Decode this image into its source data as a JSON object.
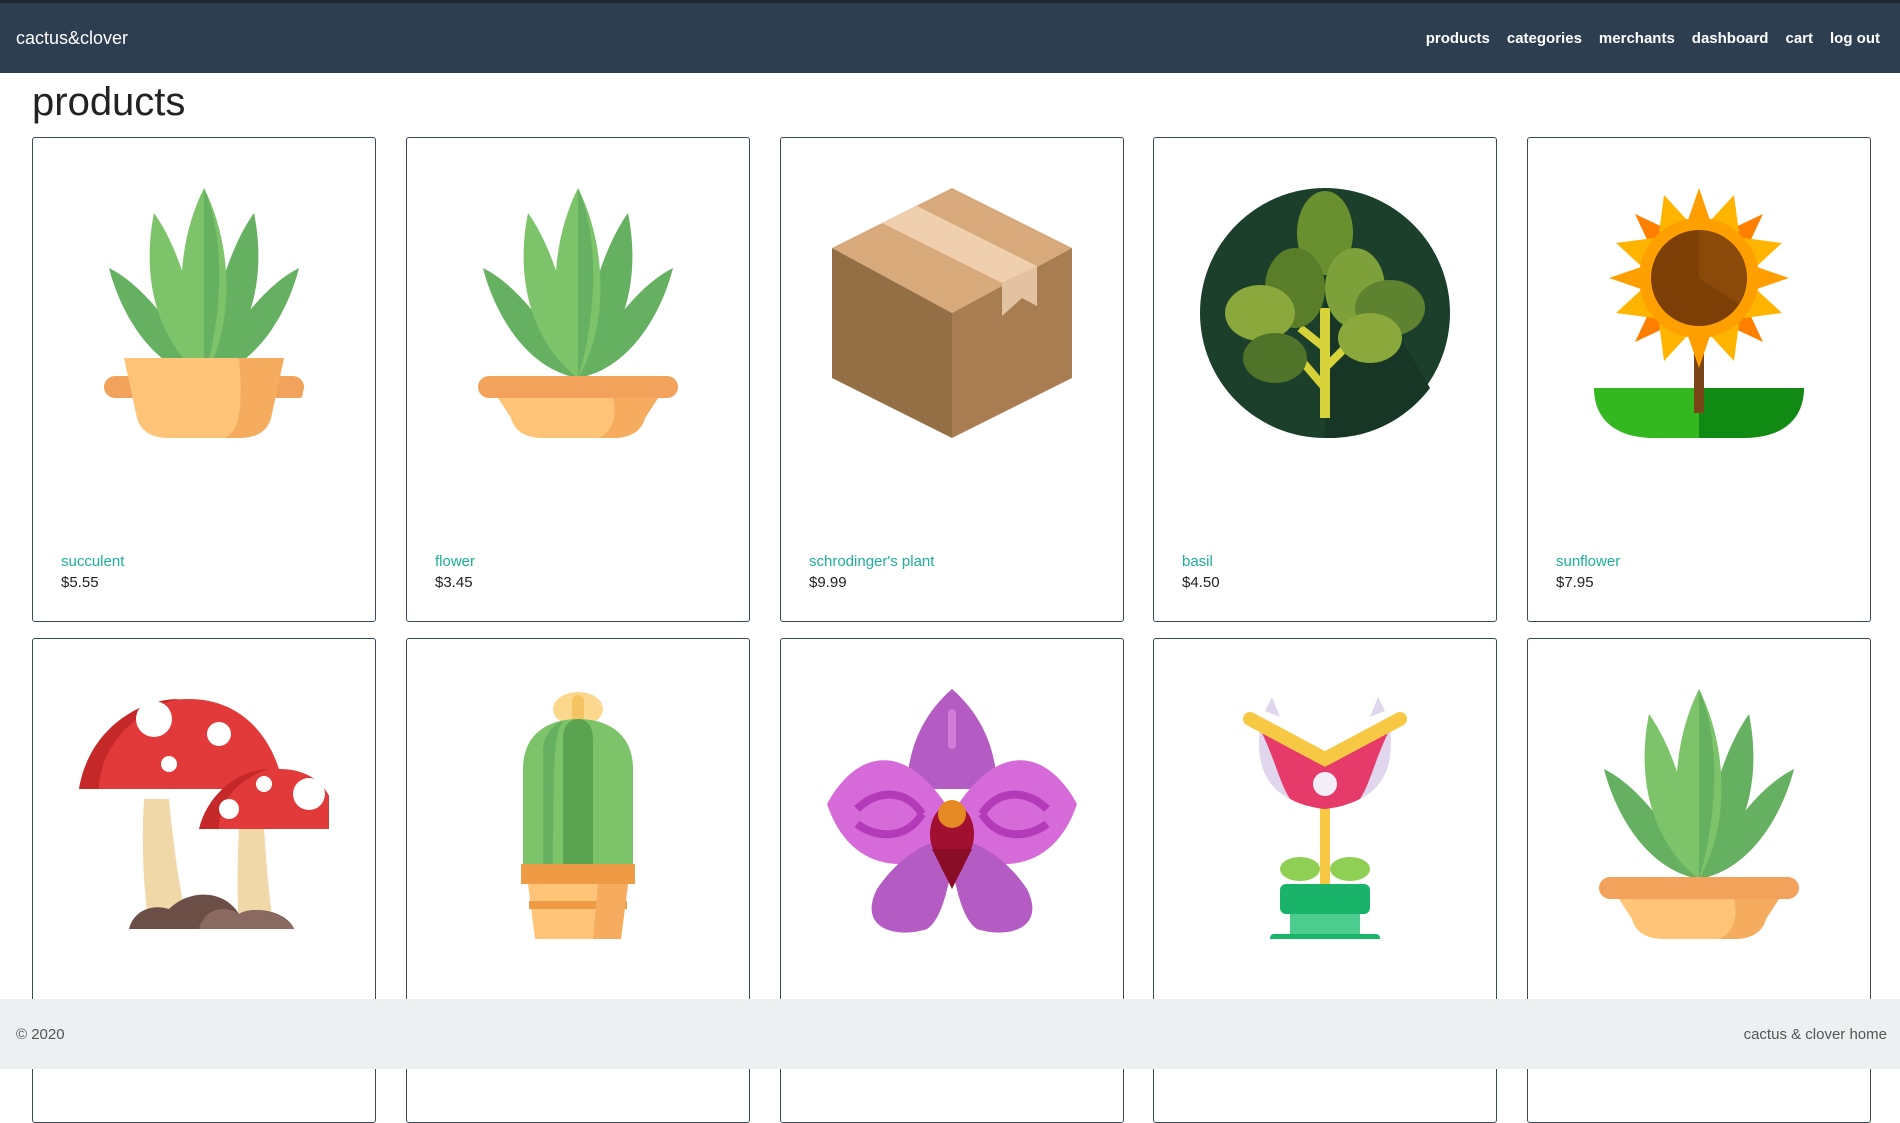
{
  "nav": {
    "brand": "cactus&clover",
    "links": [
      "products",
      "categories",
      "merchants",
      "dashboard",
      "cart",
      "log out"
    ]
  },
  "page": {
    "title": "products"
  },
  "products": [
    {
      "name": "succulent",
      "price": "$5.55",
      "icon": "succulent-icon"
    },
    {
      "name": "flower",
      "price": "$3.45",
      "icon": "succulent-icon"
    },
    {
      "name": "schrodinger's plant",
      "price": "$9.99",
      "icon": "box-icon"
    },
    {
      "name": "basil",
      "price": "$4.50",
      "icon": "basil-icon"
    },
    {
      "name": "sunflower",
      "price": "$7.95",
      "icon": "sunflower-icon"
    },
    {
      "name": "",
      "price": "",
      "icon": "mushroom-icon"
    },
    {
      "name": "",
      "price": "",
      "icon": "cactus-icon"
    },
    {
      "name": "",
      "price": "",
      "icon": "orchid-icon"
    },
    {
      "name": "",
      "price": "",
      "icon": "venus-flytrap-icon"
    },
    {
      "name": "",
      "price": "",
      "icon": "succulent-icon"
    }
  ],
  "footer": {
    "copyright": "© 2020",
    "home_link": "cactus & clover home"
  },
  "colors": {
    "navbar": "#2d3e50",
    "link": "#1bb09a",
    "footer": "#ecf0f1"
  }
}
